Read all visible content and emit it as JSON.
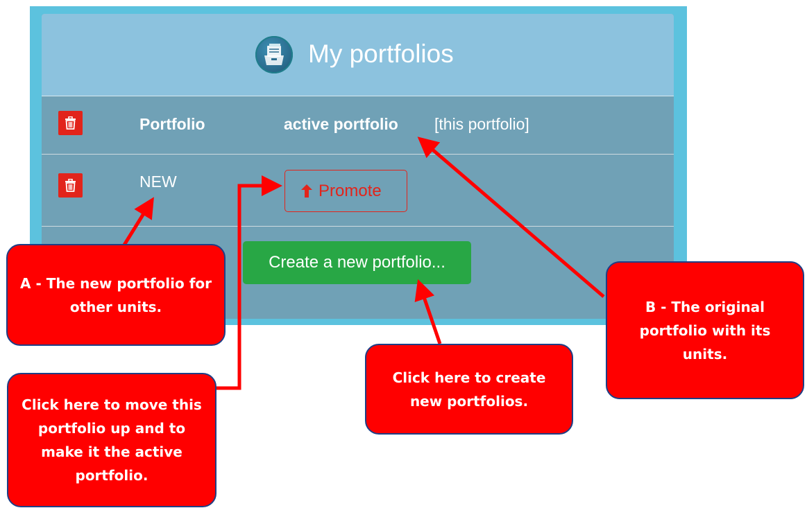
{
  "panel": {
    "title": "My portfolios",
    "logo_icon": "portfolio-folder-icon"
  },
  "rows": [
    {
      "name": "Portfolio",
      "status": "active portfolio",
      "note": "[this portfolio]",
      "delete_icon": "trash-icon"
    },
    {
      "name": "NEW",
      "action_label": "Promote",
      "action_icon": "arrow-up-icon",
      "delete_icon": "trash-icon"
    }
  ],
  "create_button": {
    "label": "Create a new portfolio..."
  },
  "annotations": {
    "a": "A - The new portfolio for other units.",
    "b": "B - The original portfolio with its units.",
    "promote": "Click here to move this portfolio up and to make it the active portfolio.",
    "create": "Click here to create new portfolios."
  },
  "colors": {
    "frame": "#5cc2de",
    "header": "#8cc2de",
    "body": "#70a1b6",
    "danger": "#e2241b",
    "success": "#28a745",
    "callout": "#ff0000",
    "callout_border": "#1e3f86"
  }
}
